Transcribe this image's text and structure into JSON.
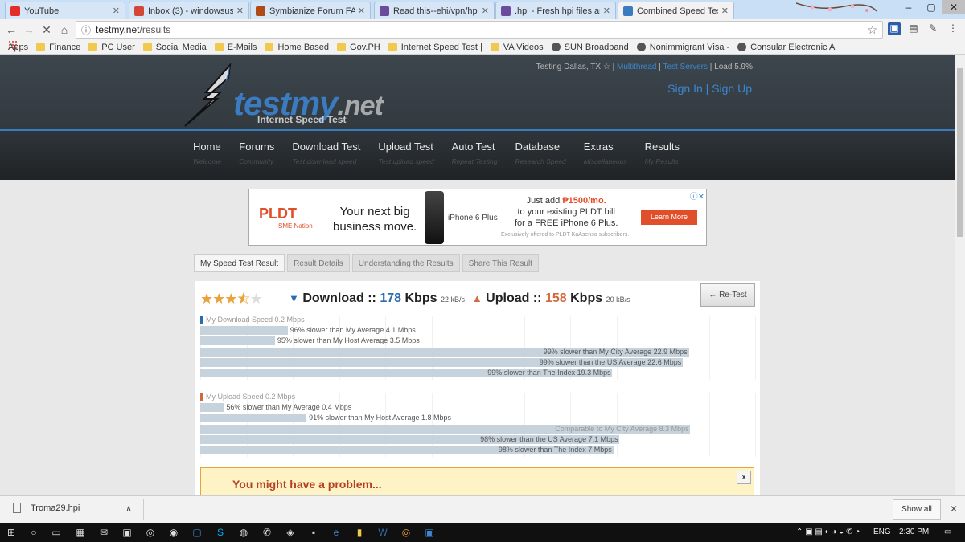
{
  "browser": {
    "tabs": [
      {
        "title": "YouTube",
        "fav_color": "#e52d27"
      },
      {
        "title": "Inbox (3) - windowsuser",
        "fav_color": "#d44638"
      },
      {
        "title": "Symbianize Forum FAQ",
        "fav_color": "#b04a18"
      },
      {
        "title": "Read this--ehi/vpn/hpi/",
        "fav_color": "#6a4b9c"
      },
      {
        "title": ".hpi - Fresh hpi files are p",
        "fav_color": "#6a4b9c"
      },
      {
        "title": "Combined Speed Test R",
        "fav_color": "#3b7bbf"
      }
    ],
    "url_host": "testmy.net",
    "url_path": "/results",
    "bookmarks": [
      {
        "label": "Apps",
        "kind": "grid"
      },
      {
        "label": "Finance",
        "kind": "folder"
      },
      {
        "label": "PC User",
        "kind": "folder"
      },
      {
        "label": "Social Media",
        "kind": "folder"
      },
      {
        "label": "E-Mails",
        "kind": "folder"
      },
      {
        "label": "Home Based",
        "kind": "folder"
      },
      {
        "label": "Gov.PH",
        "kind": "folder"
      },
      {
        "label": "Internet Speed Test |",
        "kind": "folder"
      },
      {
        "label": "VA Videos",
        "kind": "folder"
      },
      {
        "label": "SUN Broadband",
        "kind": "round"
      },
      {
        "label": "Nonimmigrant Visa -",
        "kind": "round"
      },
      {
        "label": "Consular Electronic A",
        "kind": "round"
      }
    ]
  },
  "site": {
    "logo": "testmy",
    "logo_net": ".net",
    "logo_sub": "Internet Speed Test",
    "testing": "Testing Dallas, TX",
    "multithread": "Multithread",
    "test_servers": "Test Servers",
    "load": "Load 5.9%",
    "sign_in": "Sign In",
    "sign_up": "Sign Up",
    "menu": [
      {
        "title": "Home",
        "sub": "Welcome"
      },
      {
        "title": "Forums",
        "sub": "Community"
      },
      {
        "title": "Download Test",
        "sub": "Test download speed"
      },
      {
        "title": "Upload Test",
        "sub": "Test upload speed"
      },
      {
        "title": "Auto Test",
        "sub": "Repeat Testing"
      },
      {
        "title": "Database",
        "sub": "Research Speed"
      },
      {
        "title": "Extras",
        "sub": "Miscellaneous"
      },
      {
        "title": "Results",
        "sub": "My Results"
      }
    ]
  },
  "ad": {
    "brand": "PLDT",
    "brand_sub": "SME Nation",
    "headline_1": "Your next big",
    "headline_2": "business move.",
    "model": "iPhone 6 Plus",
    "offer_1": "Just add",
    "offer_price": "₱1500/mo.",
    "offer_2": "to your existing PLDT bill",
    "offer_3": "for a FREE iPhone 6 Plus.",
    "fine": "Exclusively offered to PLDT KaAsenso subscribers.",
    "cta": "Learn More"
  },
  "result_tabs": [
    "My Speed Test Result",
    "Result Details",
    "Understanding the Results",
    "Share This Result"
  ],
  "result": {
    "rating_stars": 3.5,
    "download_label": "Download",
    "download_value": "178",
    "download_unit": "Kbps",
    "download_kbs": "22 kB/s",
    "upload_label": "Upload",
    "upload_value": "158",
    "upload_unit": "Kbps",
    "upload_kbs": "20 kB/s",
    "sep": "::",
    "retest": "← Re-Test",
    "colors": {
      "download": "#2b6cb0",
      "upload": "#d2693e",
      "bar": "#c7d3dc"
    }
  },
  "chart_data": [
    {
      "type": "bar",
      "categories": [
        "My Download Speed 0.2 Mbps",
        "96% slower than My Average 4.1 Mbps",
        "95% slower than My Host Average 3.5 Mbps",
        "99% slower than My City Average 22.9 Mbps",
        "99% slower than the US Average 22.6 Mbps",
        "99% slower than The Index 19.3 Mbps"
      ],
      "values": [
        0.178,
        4.1,
        3.5,
        22.9,
        22.6,
        19.3
      ],
      "xlim": [
        0,
        26
      ]
    },
    {
      "type": "bar",
      "categories": [
        "My Upload Speed 0.2 Mbps",
        "56% slower than My Average 0.4 Mbps",
        "91% slower than My Host Average 1.8 Mbps",
        "Comparable to My City Average 8.3 Mbps",
        "98% slower than the US Average 7.1 Mbps",
        "98% slower than The Index 7 Mbps"
      ],
      "values": [
        0.158,
        0.4,
        1.8,
        8.3,
        7.1,
        7.0
      ],
      "xlim": [
        0,
        9.4
      ]
    }
  ],
  "warning": {
    "title": "You might have a problem...",
    "close": "x"
  },
  "downloads": {
    "file": "Troma29.hpi",
    "show_all": "Show all"
  },
  "taskbar": {
    "lang": "ENG",
    "time": "2:30 PM"
  }
}
